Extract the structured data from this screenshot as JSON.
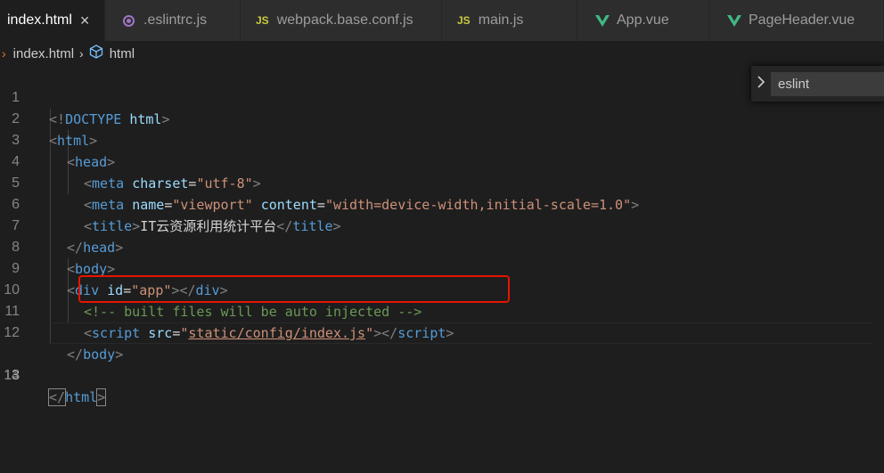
{
  "tabs": [
    {
      "label": "index.html",
      "icon": "html-file-icon",
      "active": true,
      "close": "×"
    },
    {
      "label": ".eslintrc.js",
      "icon": "eslint-icon"
    },
    {
      "label": "webpack.base.conf.js",
      "icon": "js-icon"
    },
    {
      "label": "main.js",
      "icon": "js-icon"
    },
    {
      "label": "App.vue",
      "icon": "vue-icon"
    },
    {
      "label": "PageHeader.vue",
      "icon": "vue-icon"
    }
  ],
  "js_badge": "JS",
  "breadcrumb": {
    "file": "index.html",
    "symbol": "html"
  },
  "find": {
    "value": "eslint"
  },
  "line_numbers": [
    "1",
    "2",
    "3",
    "4",
    "5",
    "6",
    "7",
    "8",
    "9",
    "10",
    "11",
    "12",
    "13",
    "14"
  ],
  "code": {
    "l1": {
      "open": "<!",
      "doctype": "DOCTYPE",
      "sp": " ",
      "html": "html",
      "close": ">"
    },
    "l2": {
      "open": "<",
      "tag": "html",
      "close": ">"
    },
    "l3": {
      "open": "<",
      "tag": "head",
      "close": ">"
    },
    "l4": {
      "open": "<",
      "tag": "meta",
      "attr": "charset",
      "eq": "=",
      "val": "\"utf-8\"",
      "close": ">"
    },
    "l5": {
      "open": "<",
      "tag": "meta",
      "attr1": "name",
      "eq": "=",
      "val1": "\"viewport\"",
      "attr2": "content",
      "val2": "\"width=device-width,initial-scale=1.0\"",
      "close": ">"
    },
    "l6": {
      "open": "<",
      "tag": "title",
      "close": ">",
      "text": "IT云资源利用统计平台",
      "eopen": "</",
      "etag": "title",
      "eclose": ">"
    },
    "l7": {
      "open": "</",
      "tag": "head",
      "close": ">"
    },
    "l8": {
      "open": "<",
      "tag": "body",
      "close": ">"
    },
    "l9": {
      "open": "<",
      "tag": "div",
      "attr": "id",
      "eq": "=",
      "val": "\"app\"",
      "close": ">",
      "eopen": "</",
      "etag": "div",
      "eclose": ">"
    },
    "l10": {
      "comment": "<!-- built files will be auto injected -->"
    },
    "l11": {
      "open": "<",
      "tag": "script",
      "attr": "src",
      "eq": "=",
      "q1": "\"",
      "val": "static/config/index.js",
      "q2": "\"",
      "close": ">",
      "eopen": "</",
      "etag": "script",
      "eclose": ">"
    },
    "l12": {
      "open": "</",
      "tag": "body",
      "close": ">"
    },
    "l13": {
      "open": "</",
      "tag": "html",
      "close": ">"
    }
  },
  "colors": {
    "highlight_box": "#e51400",
    "tag": "#569cd6",
    "attr": "#9cdcfe",
    "string": "#ce9178",
    "comment": "#6a9955"
  }
}
